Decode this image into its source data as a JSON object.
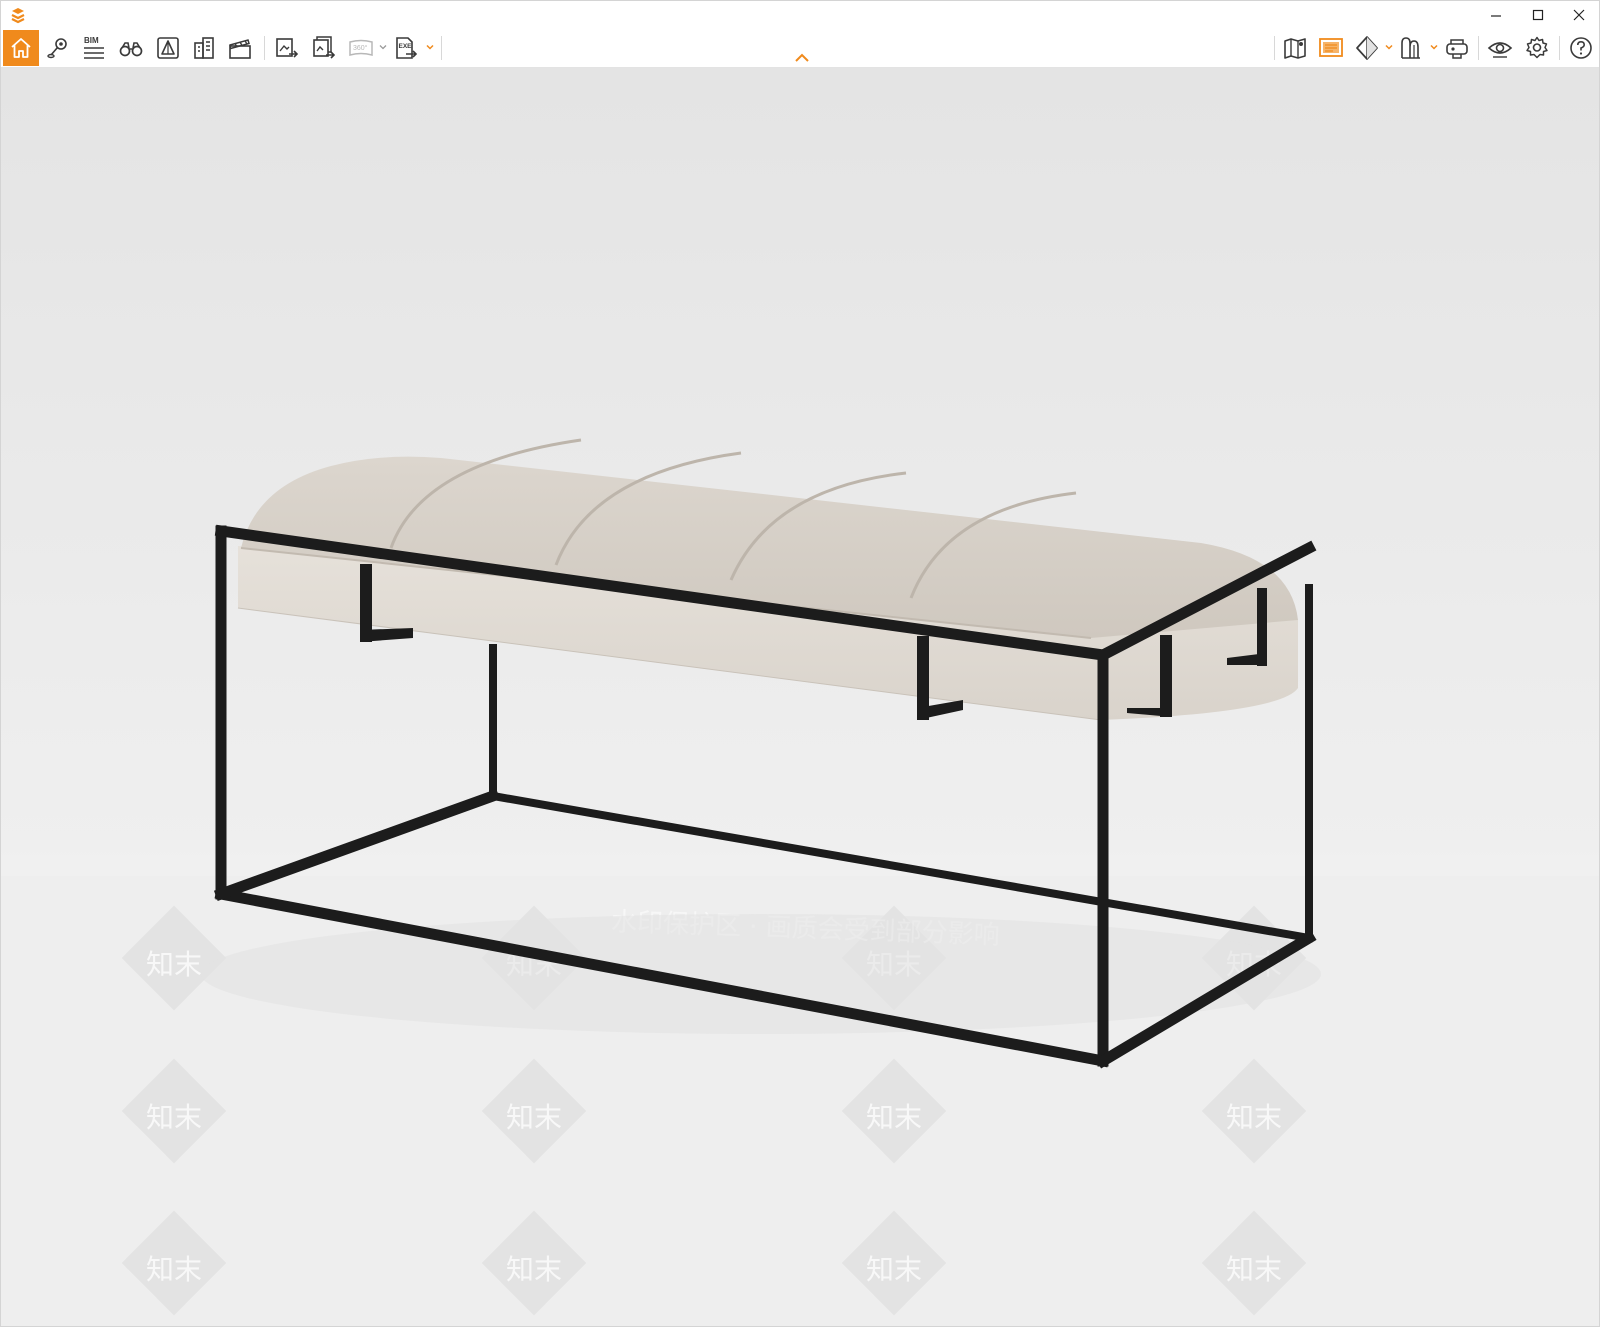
{
  "titlebar": {
    "window_controls": [
      "minimize-icon",
      "maximize-icon",
      "close-icon"
    ]
  },
  "toolbar": {
    "bim_label": "BIM",
    "pano_label": "360°",
    "exe_label": "EXE",
    "left_tools": [
      "home-icon",
      "location-pin-icon",
      "bim-icon",
      "binoculars-icon",
      "section-icon",
      "buildings-icon",
      "clapper-icon",
      "export-image-icon",
      "batch-export-icon",
      "panorama-icon",
      "exe-export-icon"
    ],
    "right_tools": [
      "map-icon",
      "render-icon",
      "cube-icon",
      "material-icon",
      "vr-icon",
      "eye-icon",
      "gear-icon",
      "help-icon"
    ]
  },
  "viewport": {
    "watermark_label": "知末",
    "watermark_banner": "水印保护区 · 画质会受到部分影响"
  },
  "colors": {
    "accent": "#f08a1c",
    "icon": "#3a3a3a",
    "cushion": "#d7d1c9",
    "frame": "#1c1c1c"
  }
}
